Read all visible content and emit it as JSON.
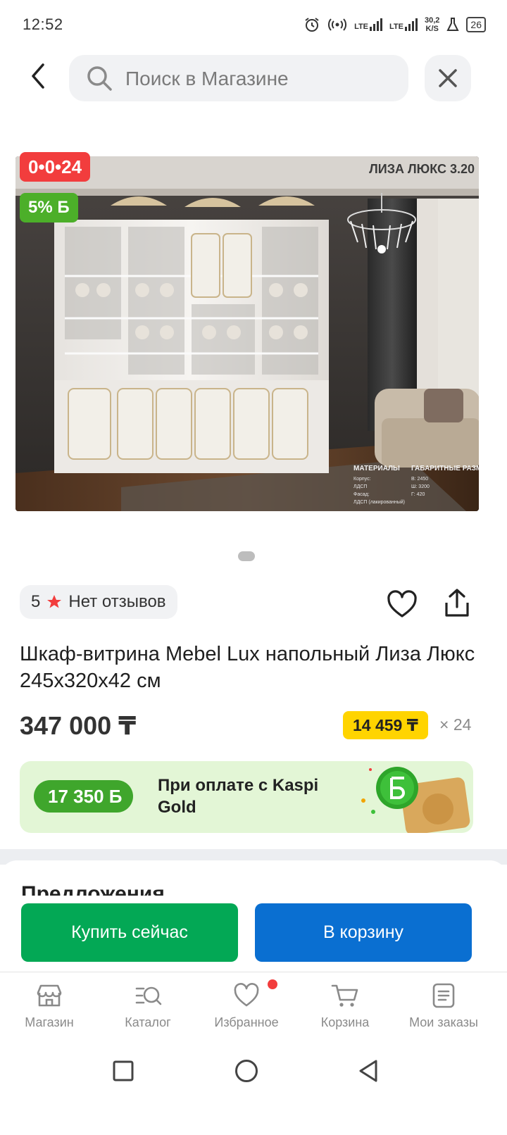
{
  "status_bar": {
    "time": "12:52",
    "lte1": "LTE",
    "lte2": "LTE",
    "speed_value": "30,2",
    "speed_unit": "K/S",
    "battery": "26"
  },
  "search": {
    "placeholder": "Поиск в Магазине"
  },
  "product": {
    "timer": "0•0•24",
    "bonus_percent": "5% Б",
    "image_caption": "ЛИЗА ЛЮКС 3.20",
    "materials_header": "МАТЕРИАЛЫ",
    "sizes_header": "ГАБАРИТНЫЕ РАЗМЕРЫ",
    "materials_lines": [
      "Корпус:",
      "ЛДСП",
      "Фасад:",
      "ЛДСП (лакированный)"
    ],
    "sizes_lines": [
      "В: 2450",
      "Ш: 3200",
      "Г: 420"
    ],
    "rating_value": "5",
    "reviews_label": "Нет отзывов",
    "title": "Шкаф-витрина Mebel Lux напольный Лиза Люкс 245x320x42 см",
    "price": "347 000 ₸",
    "installment": "14 459 ₸",
    "installment_months": "× 24"
  },
  "kaspi_banner": {
    "bonus": "17 350 Б",
    "text": "При оплате с Kaspi Gold"
  },
  "offers": {
    "title": "Предложения"
  },
  "actions": {
    "buy_now": "Купить сейчас",
    "add_to_cart": "В корзину"
  },
  "bottom_nav": {
    "items": [
      {
        "label": "Магазин",
        "icon": "store-icon"
      },
      {
        "label": "Каталог",
        "icon": "catalog-search-icon"
      },
      {
        "label": "Избранное",
        "icon": "heart-icon"
      },
      {
        "label": "Корзина",
        "icon": "cart-icon"
      },
      {
        "label": "Мои заказы",
        "icon": "orders-icon"
      }
    ]
  },
  "colors": {
    "buy_green": "#03a855",
    "cart_blue": "#0a6fd1",
    "timer_red": "#f23d3d",
    "bonus_green": "#4caf29",
    "installment_yellow": "#ffd400",
    "kaspi_banner_bg": "#e3f6d6"
  }
}
